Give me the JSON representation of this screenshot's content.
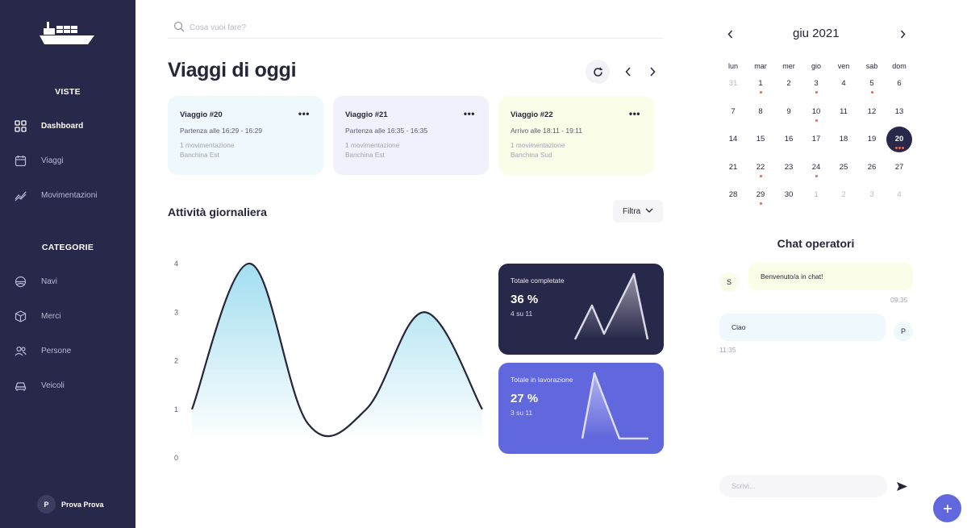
{
  "sidebar": {
    "sections": {
      "views": "VISTE",
      "categories": "CATEGORIE"
    },
    "items": [
      {
        "label": "Dashboard",
        "icon": "grid-icon",
        "active": true
      },
      {
        "label": "Viaggi",
        "icon": "calendar-icon",
        "active": false
      },
      {
        "label": "Movimentazioni",
        "icon": "trend-icon",
        "active": false
      },
      {
        "label": "Navi",
        "icon": "ship-wheel-icon",
        "active": false
      },
      {
        "label": "Merci",
        "icon": "box-icon",
        "active": false
      },
      {
        "label": "Persone",
        "icon": "people-icon",
        "active": false
      },
      {
        "label": "Veicoli",
        "icon": "car-icon",
        "active": false
      }
    ],
    "user": {
      "initial": "P",
      "name": "Prova Prova"
    }
  },
  "search": {
    "placeholder": "Cosa vuoi fare?"
  },
  "main": {
    "title": "Viaggi di oggi",
    "trips": [
      {
        "name": "Viaggio #20",
        "time": "Partenza alle 16:29 - 16:29",
        "movements": "1 movimentazione",
        "dock": "Banchina Est",
        "color": "#eef9fd"
      },
      {
        "name": "Viaggio #21",
        "time": "Partenza alle 16:35 - 16:35",
        "movements": "1 movimentazione",
        "dock": "Banchina Est",
        "color": "#f1f1fd"
      },
      {
        "name": "Viaggio #22",
        "time": "Arrivo alle 18:11 - 19:11",
        "movements": "1 movimentazione",
        "dock": "Banchina Sud",
        "color": "#fafde8"
      }
    ],
    "activity_title": "Attività giornaliera",
    "filter_label": "Filtra"
  },
  "chart_data": {
    "type": "area",
    "x": [
      0,
      1,
      2,
      3,
      4,
      5
    ],
    "values": [
      1,
      4,
      0.7,
      1,
      3,
      1
    ],
    "yticks": [
      "0",
      "1",
      "2",
      "3",
      "4"
    ],
    "ylim": [
      0,
      4
    ],
    "line_color": "#26263a",
    "fill_color": "#9ddcef"
  },
  "stats": [
    {
      "label": "Totale completate",
      "value": "36 %",
      "sub": "4 su 11",
      "color": "#28284a"
    },
    {
      "label": "Totale in lavorazione",
      "value": "27 %",
      "sub": "3 su 11",
      "color": "#6167dd"
    }
  ],
  "calendar": {
    "month": "giu 2021",
    "dow": [
      "lun",
      "mar",
      "mer",
      "gio",
      "ven",
      "sab",
      "dom"
    ],
    "weeks": [
      [
        [
          "31",
          true
        ],
        [
          "1",
          false
        ],
        [
          "2",
          false
        ],
        [
          "3",
          false
        ],
        [
          "4",
          false
        ],
        [
          "5",
          false
        ],
        [
          "6",
          false
        ]
      ],
      [
        [
          "7",
          false
        ],
        [
          "8",
          false
        ],
        [
          "9",
          false
        ],
        [
          "10",
          false
        ],
        [
          "11",
          false
        ],
        [
          "12",
          false
        ],
        [
          "13",
          false
        ]
      ],
      [
        [
          "14",
          false
        ],
        [
          "15",
          false
        ],
        [
          "16",
          false
        ],
        [
          "17",
          false
        ],
        [
          "18",
          false
        ],
        [
          "19",
          false
        ],
        [
          "20",
          false
        ]
      ],
      [
        [
          "21",
          false
        ],
        [
          "22",
          false
        ],
        [
          "23",
          false
        ],
        [
          "24",
          false
        ],
        [
          "25",
          false
        ],
        [
          "26",
          false
        ],
        [
          "27",
          false
        ]
      ],
      [
        [
          "28",
          false
        ],
        [
          "29",
          false
        ],
        [
          "30",
          false
        ],
        [
          "1",
          true
        ],
        [
          "2",
          true
        ],
        [
          "3",
          true
        ],
        [
          "4",
          true
        ]
      ]
    ],
    "today": "20",
    "event_days": [
      "1",
      "3",
      "5",
      "10",
      "22",
      "24",
      "29"
    ],
    "event_color": "#e8654a"
  },
  "chat": {
    "title": "Chat operatori",
    "messages": [
      {
        "initial": "S",
        "text": "Benvenuto/a in chat!",
        "time": "09:35",
        "color": "#fafde8"
      },
      {
        "initial": "P",
        "text": "Ciao",
        "time": "11:35",
        "color": "#eef9fd"
      }
    ],
    "input_placeholder": "Scrivi..."
  }
}
